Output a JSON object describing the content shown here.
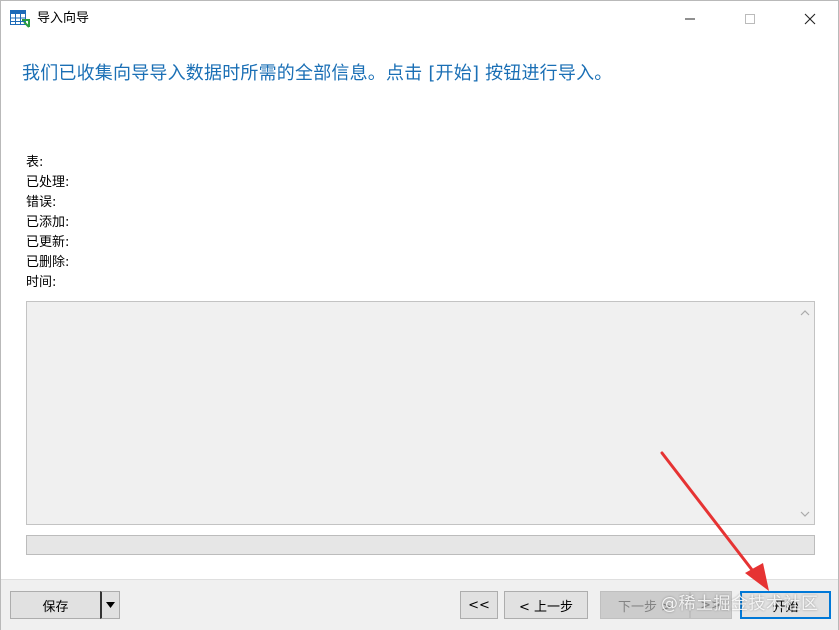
{
  "window": {
    "title": "导入向导",
    "app_icon": "table-import-icon"
  },
  "headline": "我们已收集向导导入数据时所需的全部信息。点击 [开始] 按钮进行导入。",
  "stats": [
    {
      "label": "表:"
    },
    {
      "label": "已处理:"
    },
    {
      "label": "错误:"
    },
    {
      "label": "已添加:"
    },
    {
      "label": "已更新:"
    },
    {
      "label": "已删除:"
    },
    {
      "label": "时间:"
    }
  ],
  "progress": {
    "value": 0
  },
  "footer": {
    "save_label": "保存",
    "first_label": "<<",
    "prev_label": "< 上一步",
    "next_label": "下一步 >",
    "last_label": ">>",
    "start_label": "开始"
  },
  "watermark": "@稀土掘金技术社区",
  "colors": {
    "headline": "#1a6fb5",
    "annotation_arrow": "#e63333",
    "default_button_border": "#0078d7"
  }
}
